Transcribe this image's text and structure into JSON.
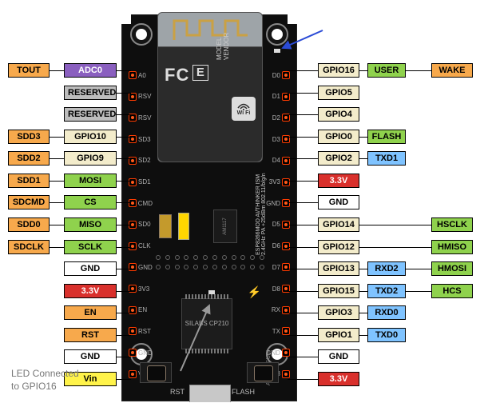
{
  "chip": {
    "fc_label": "FC",
    "ce_label": "E",
    "model_vendor": "MODEL VENDOR",
    "part": "ESP8266MOD AI/THINKER ISM 2.4GHz PA +25dBm 802.11/b/g/n",
    "wifi": "Wi Fi",
    "regulator": "AM1117",
    "usb_chip": "SILABS CP210",
    "btn_rst": "RST",
    "btn_flash": "FLASH",
    "brand": "AYARAFUN"
  },
  "note": {
    "line1": "LED Connected",
    "line2": "to GPIO16"
  },
  "left_silks": [
    "A0",
    "RSV",
    "RSV",
    "SD3",
    "SD2",
    "SD1",
    "CMD",
    "SD0",
    "CLK",
    "GND",
    "3V3",
    "EN",
    "RST",
    "GND",
    "VIN"
  ],
  "right_silks": [
    "D0",
    "D1",
    "D2",
    "D3",
    "D4",
    "3V3",
    "GND",
    "D5",
    "D6",
    "D7",
    "D8",
    "RX",
    "TX",
    "GND",
    "3V3"
  ],
  "left": [
    {
      "a": {
        "t": "TOUT",
        "c": "c-orange"
      },
      "b": {
        "t": "ADC0",
        "c": "c-purple"
      }
    },
    {
      "b": {
        "t": "RESERVED",
        "c": "c-gray"
      }
    },
    {
      "b": {
        "t": "RESERVED",
        "c": "c-gray"
      }
    },
    {
      "a": {
        "t": "SDD3",
        "c": "c-orange"
      },
      "b": {
        "t": "GPIO10",
        "c": "c-cream"
      }
    },
    {
      "a": {
        "t": "SDD2",
        "c": "c-orange"
      },
      "b": {
        "t": "GPIO9",
        "c": "c-cream"
      }
    },
    {
      "a": {
        "t": "SDD1",
        "c": "c-orange"
      },
      "b": {
        "t": "MOSI",
        "c": "c-green"
      }
    },
    {
      "a": {
        "t": "SDCMD",
        "c": "c-orange"
      },
      "b": {
        "t": "CS",
        "c": "c-green"
      }
    },
    {
      "a": {
        "t": "SDD0",
        "c": "c-orange"
      },
      "b": {
        "t": "MISO",
        "c": "c-green"
      }
    },
    {
      "a": {
        "t": "SDCLK",
        "c": "c-orange"
      },
      "b": {
        "t": "SCLK",
        "c": "c-green"
      }
    },
    {
      "b": {
        "t": "GND",
        "c": "c-white"
      }
    },
    {
      "b": {
        "t": "3.3V",
        "c": "c-red"
      }
    },
    {
      "b": {
        "t": "EN",
        "c": "c-orange"
      }
    },
    {
      "b": {
        "t": "RST",
        "c": "c-orange"
      }
    },
    {
      "b": {
        "t": "GND",
        "c": "c-white"
      }
    },
    {
      "b": {
        "t": "Vin",
        "c": "c-yellow"
      }
    }
  ],
  "right": [
    {
      "a": {
        "t": "GPIO16",
        "c": "c-cream"
      },
      "b": {
        "t": "USER",
        "c": "c-green"
      },
      "c": {
        "t": "WAKE",
        "c": "c-orange"
      }
    },
    {
      "a": {
        "t": "GPIO5",
        "c": "c-cream"
      }
    },
    {
      "a": {
        "t": "GPIO4",
        "c": "c-cream"
      }
    },
    {
      "a": {
        "t": "GPIO0",
        "c": "c-cream"
      },
      "b": {
        "t": "FLASH",
        "c": "c-green"
      }
    },
    {
      "a": {
        "t": "GPIO2",
        "c": "c-cream"
      },
      "b": {
        "t": "TXD1",
        "c": "c-blue"
      }
    },
    {
      "a": {
        "t": "3.3V",
        "c": "c-red"
      }
    },
    {
      "a": {
        "t": "GND",
        "c": "c-white"
      }
    },
    {
      "a": {
        "t": "GPIO14",
        "c": "c-cream"
      },
      "c": {
        "t": "HSCLK",
        "c": "c-green"
      }
    },
    {
      "a": {
        "t": "GPIO12",
        "c": "c-cream"
      },
      "c": {
        "t": "HMISO",
        "c": "c-green"
      }
    },
    {
      "a": {
        "t": "GPIO13",
        "c": "c-cream"
      },
      "b": {
        "t": "RXD2",
        "c": "c-blue"
      },
      "c": {
        "t": "HMOSI",
        "c": "c-green"
      }
    },
    {
      "a": {
        "t": "GPIO15",
        "c": "c-cream"
      },
      "b": {
        "t": "TXD2",
        "c": "c-blue"
      },
      "c": {
        "t": "HCS",
        "c": "c-green"
      }
    },
    {
      "a": {
        "t": "GPIO3",
        "c": "c-cream"
      },
      "b": {
        "t": "RXD0",
        "c": "c-blue"
      }
    },
    {
      "a": {
        "t": "GPIO1",
        "c": "c-cream"
      },
      "b": {
        "t": "TXD0",
        "c": "c-blue"
      }
    },
    {
      "a": {
        "t": "GND",
        "c": "c-white"
      }
    },
    {
      "a": {
        "t": "3.3V",
        "c": "c-red"
      }
    }
  ]
}
